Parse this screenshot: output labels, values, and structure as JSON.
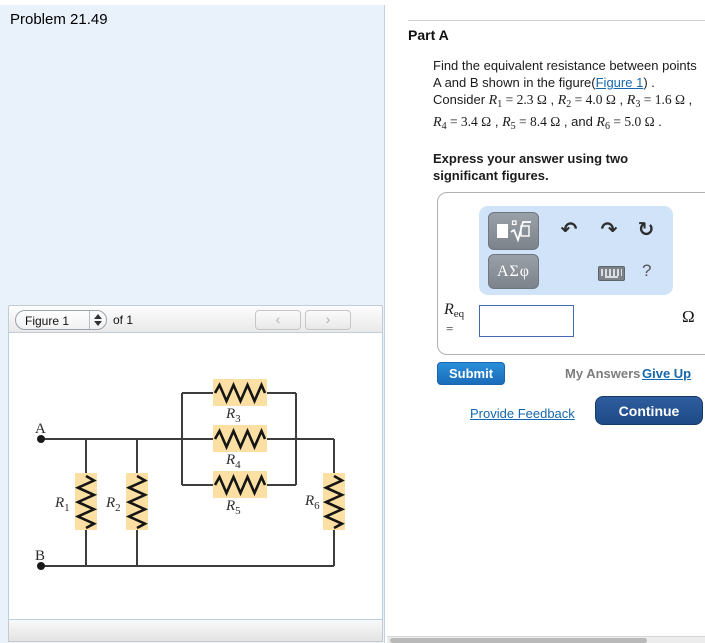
{
  "window": {
    "title": "Problem 21.49"
  },
  "figure_panel": {
    "selector_value": "Figure 1",
    "count_label": "of 1",
    "prev_label": "‹",
    "next_label": "›",
    "node_a": "A",
    "node_b": "B",
    "resistors": [
      {
        "base": "R",
        "sub": "1"
      },
      {
        "base": "R",
        "sub": "2"
      },
      {
        "base": "R",
        "sub": "3"
      },
      {
        "base": "R",
        "sub": "4"
      },
      {
        "base": "R",
        "sub": "5"
      },
      {
        "base": "R",
        "sub": "6"
      }
    ]
  },
  "part_a": {
    "heading": "Part A",
    "problem": {
      "p1": "Find the equivalent resistance between points A and B shown in the figure(",
      "figure_link": "Figure 1",
      "p2": ") . Consider ",
      "m1": {
        "b": "R",
        "s": "1",
        "v": " = 2.3 Ω"
      },
      "s1": " , ",
      "m2": {
        "b": "R",
        "s": "2",
        "v": " = 4.0 Ω"
      },
      "s2": " , ",
      "m3": {
        "b": "R",
        "s": "3",
        "v": " = 1.6 Ω"
      },
      "s3": " , ",
      "m4": {
        "b": "R",
        "s": "4",
        "v": " = 3.4 Ω"
      },
      "s4": " , ",
      "m5": {
        "b": "R",
        "s": "5",
        "v": " = 8.4 Ω"
      },
      "s5": " , and ",
      "m6": {
        "b": "R",
        "s": "6",
        "v": " = 5.0 Ω"
      },
      "s6": " ."
    },
    "express": "Express your answer using two significant figures."
  },
  "answer_box": {
    "toolbar": {
      "greek_label": "ΑΣφ",
      "undo_icon": "↶",
      "redo_icon": "↷",
      "reset_icon": "↻",
      "help_label": "?"
    },
    "label_base": "R",
    "label_sub": "eq",
    "equals_sign": "=",
    "input_value": "",
    "unit": "Ω"
  },
  "actions": {
    "submit": "Submit",
    "my_answers": "My Answers",
    "give_up": "Give Up",
    "provide_feedback": "Provide Feedback",
    "continue": "Continue"
  },
  "colors": {
    "left_panel_bg": "#e9f1fa",
    "toolbar_bg": "#d0e3f8",
    "resistor_highlight": "#fbdfa3",
    "submit_blue": "#1a6cba",
    "continue_navy": "#1f4a86",
    "link_blue": "#1667ad"
  }
}
